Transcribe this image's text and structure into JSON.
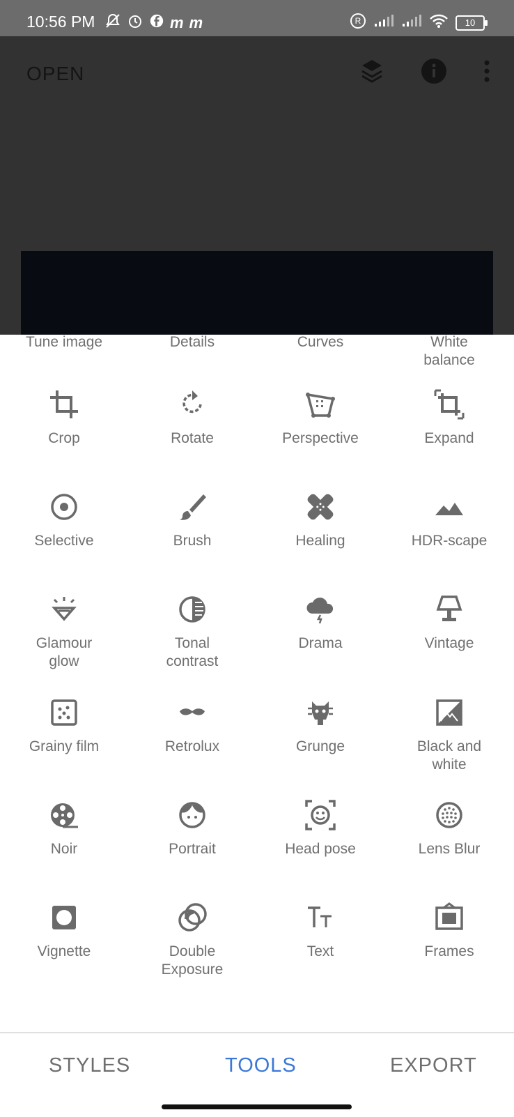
{
  "status": {
    "time": "10:56 PM",
    "left_icons": [
      "muted-bell-icon",
      "alarm-icon",
      "facebook-icon",
      "messenger-icon",
      "messenger-icon"
    ],
    "right_icons": [
      "registered-icon",
      "signal-icon",
      "signal-icon",
      "wifi-icon"
    ],
    "battery_level": "10"
  },
  "header": {
    "open_label": "OPEN",
    "actions": [
      "layers-undo-icon",
      "info-icon",
      "more-vert-icon"
    ]
  },
  "tools": [
    {
      "label": "Tune image",
      "icon": "tune-image-icon"
    },
    {
      "label": "Details",
      "icon": "details-icon"
    },
    {
      "label": "Curves",
      "icon": "curves-icon"
    },
    {
      "label": "White\nbalance",
      "icon": "white-balance-icon"
    },
    {
      "label": "Crop",
      "icon": "crop-icon"
    },
    {
      "label": "Rotate",
      "icon": "rotate-icon"
    },
    {
      "label": "Perspective",
      "icon": "perspective-icon"
    },
    {
      "label": "Expand",
      "icon": "expand-icon"
    },
    {
      "label": "Selective",
      "icon": "selective-icon"
    },
    {
      "label": "Brush",
      "icon": "brush-icon"
    },
    {
      "label": "Healing",
      "icon": "healing-icon"
    },
    {
      "label": "HDR-scape",
      "icon": "hdr-scape-icon"
    },
    {
      "label": "Glamour\nglow",
      "icon": "glamour-glow-icon"
    },
    {
      "label": "Tonal\ncontrast",
      "icon": "tonal-contrast-icon"
    },
    {
      "label": "Drama",
      "icon": "drama-icon"
    },
    {
      "label": "Vintage",
      "icon": "vintage-icon"
    },
    {
      "label": "Grainy film",
      "icon": "grainy-film-icon"
    },
    {
      "label": "Retrolux",
      "icon": "retrolux-icon"
    },
    {
      "label": "Grunge",
      "icon": "grunge-icon"
    },
    {
      "label": "Black and\nwhite",
      "icon": "black-and-white-icon"
    },
    {
      "label": "Noir",
      "icon": "noir-icon"
    },
    {
      "label": "Portrait",
      "icon": "portrait-icon"
    },
    {
      "label": "Head pose",
      "icon": "head-pose-icon"
    },
    {
      "label": "Lens Blur",
      "icon": "lens-blur-icon"
    },
    {
      "label": "Vignette",
      "icon": "vignette-icon"
    },
    {
      "label": "Double\nExposure",
      "icon": "double-exposure-icon"
    },
    {
      "label": "Text",
      "icon": "text-icon"
    },
    {
      "label": "Frames",
      "icon": "frames-icon"
    }
  ],
  "nav": {
    "styles": "STYLES",
    "tools": "TOOLS",
    "export": "EXPORT",
    "active_tab": "tools"
  },
  "colors": {
    "accent": "#3a78d8",
    "nav_inactive": "#6e6e6e",
    "icon_gray": "#6a6a6a"
  }
}
